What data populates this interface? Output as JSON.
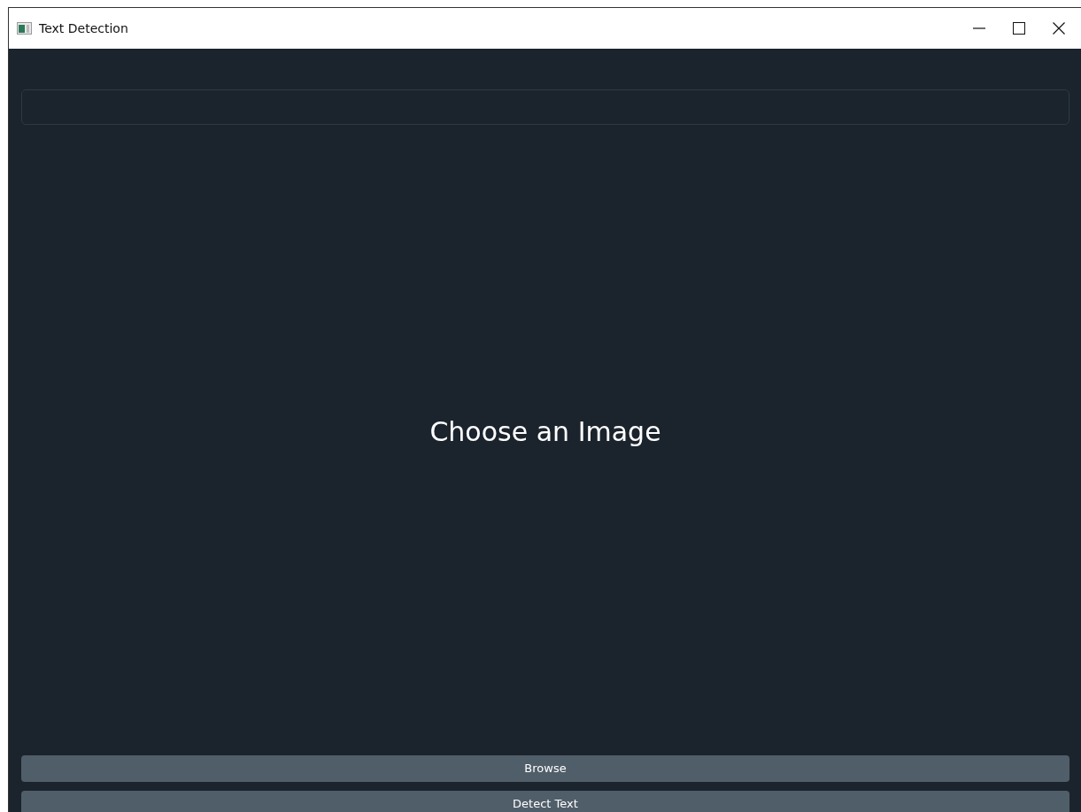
{
  "window": {
    "title": "Text Detection"
  },
  "image_area": {
    "label": "Choose an Image"
  },
  "buttons": [
    {
      "label": "Browse"
    },
    {
      "label": "Detect Text"
    }
  ]
}
